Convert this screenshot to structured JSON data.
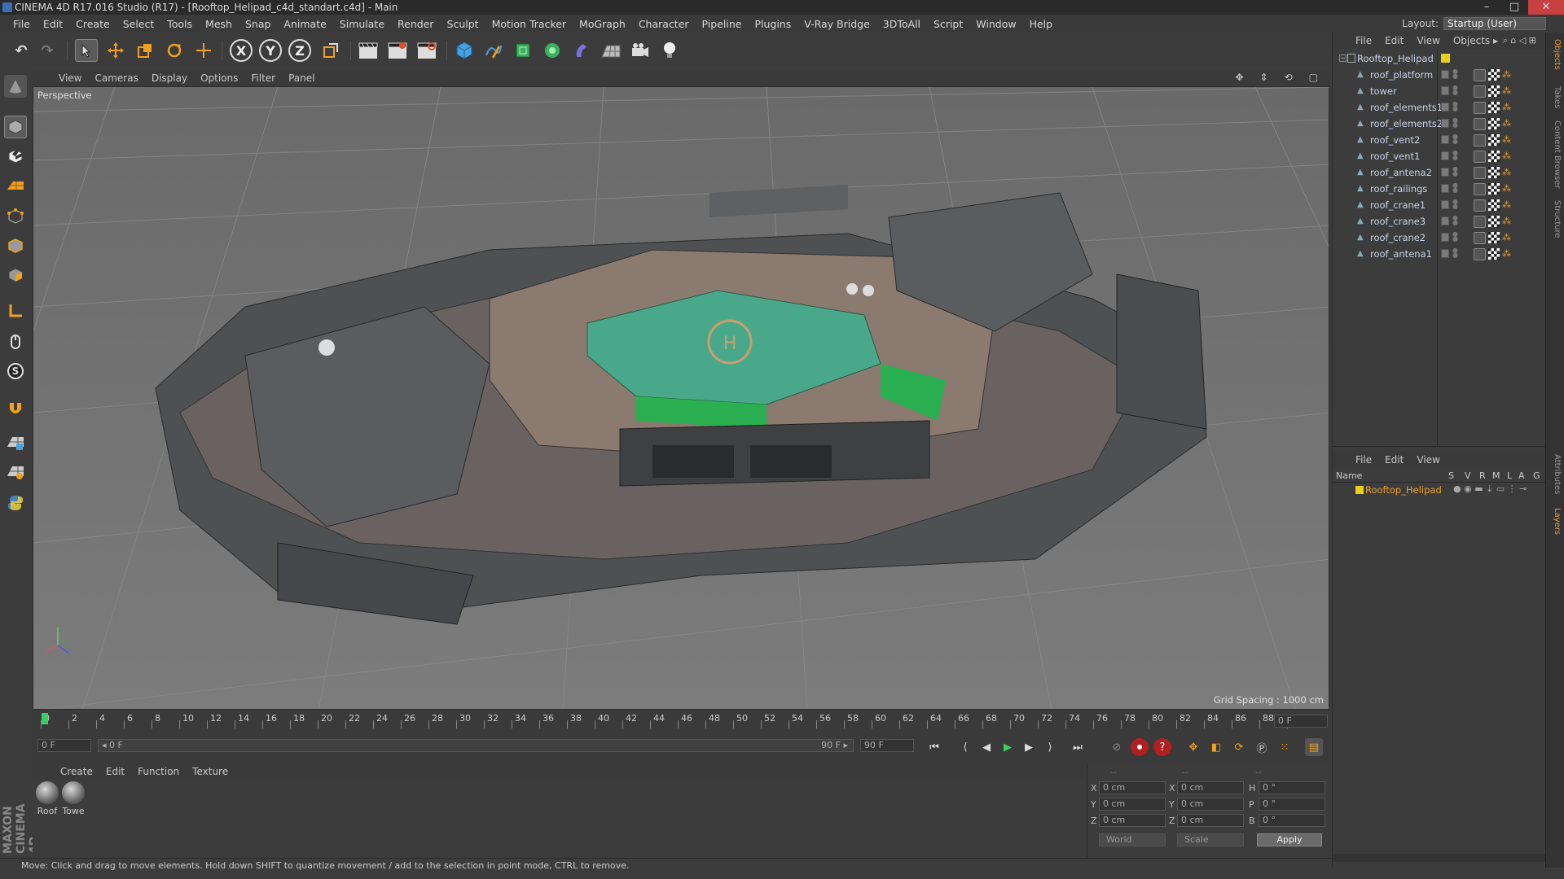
{
  "window": {
    "title": "CINEMA 4D R17.016 Studio (R17) - [Rooftop_Helipad_c4d_standart.c4d] - Main",
    "buttons": [
      "–",
      "□",
      "✕"
    ]
  },
  "menubar": [
    "File",
    "Edit",
    "Create",
    "Select",
    "Tools",
    "Mesh",
    "Snap",
    "Animate",
    "Simulate",
    "Render",
    "Sculpt",
    "Motion Tracker",
    "MoGraph",
    "Character",
    "Pipeline",
    "Plugins",
    "V-Ray Bridge",
    "3DToAll",
    "Script",
    "Window",
    "Help"
  ],
  "layout": {
    "label": "Layout:",
    "value": "Startup (User)"
  },
  "toolbar": {
    "undo": "↶",
    "redo": "↷",
    "axes": [
      "X",
      "Y",
      "Z"
    ]
  },
  "viewport": {
    "menu": [
      "View",
      "Cameras",
      "Display",
      "Options",
      "Filter",
      "Panel"
    ],
    "label": "Perspective",
    "grid_spacing": "Grid Spacing : 1000 cm"
  },
  "timeline": {
    "ticks": [
      "0",
      "2",
      "4",
      "6",
      "8",
      "10",
      "12",
      "14",
      "16",
      "18",
      "20",
      "22",
      "24",
      "26",
      "28",
      "30",
      "32",
      "34",
      "36",
      "38",
      "40",
      "42",
      "44",
      "46",
      "48",
      "50",
      "52",
      "54",
      "56",
      "58",
      "60",
      "62",
      "64",
      "66",
      "68",
      "70",
      "72",
      "74",
      "76",
      "78",
      "80",
      "82",
      "84",
      "86",
      "88",
      "90"
    ],
    "current_frame": "0 F"
  },
  "transport": {
    "start_field": "0 F",
    "range_start": "◂ 0 F",
    "range_end": "90 F ▸",
    "end_field": "90 F"
  },
  "material_manager": {
    "menu": [
      "Create",
      "Edit",
      "Function",
      "Texture"
    ],
    "materials": [
      {
        "label": "Roof"
      },
      {
        "label": "Towe"
      }
    ]
  },
  "coordinates": {
    "headers": [
      "--",
      "--",
      "--"
    ],
    "rows": [
      {
        "a": "X",
        "av": "0 cm",
        "b": "X",
        "bv": "0 cm",
        "c": "H",
        "cv": "0 °"
      },
      {
        "a": "Y",
        "av": "0 cm",
        "b": "Y",
        "bv": "0 cm",
        "c": "P",
        "cv": "0 °"
      },
      {
        "a": "Z",
        "av": "0 cm",
        "b": "Z",
        "bv": "0 cm",
        "c": "B",
        "cv": "0 °"
      }
    ],
    "mode1": "World",
    "mode2": "Scale",
    "apply": "Apply"
  },
  "status_bar": "Move: Click and drag to move elements. Hold down SHIFT to quantize movement / add to the selection in point mode, CTRL to remove.",
  "object_manager": {
    "menu": [
      "File",
      "Edit",
      "View",
      "Objects ▸"
    ],
    "root": "Rooftop_Helipad",
    "objects": [
      "roof_platform",
      "tower",
      "roof_elements1",
      "roof_elements2",
      "roof_vent2",
      "roof_vent1",
      "roof_antena2",
      "roof_railings",
      "roof_crane1",
      "roof_crane3",
      "roof_crane2",
      "roof_antena1"
    ]
  },
  "layer_manager": {
    "menu": [
      "File",
      "Edit",
      "View"
    ],
    "columns": [
      "Name",
      "S",
      "V",
      "R",
      "M",
      "L",
      "A",
      "G"
    ],
    "layers": [
      {
        "name": "Rooftop_Helipad",
        "color": "#e8d020"
      }
    ]
  },
  "side_tabs": [
    "Objects",
    "Takes",
    "Content Browser",
    "Structure",
    "Attributes",
    "Layers"
  ],
  "brand": "MAXON CINEMA 4D",
  "colors": {
    "accent": "#e89a30",
    "layer_text": "#e8a030",
    "viewport_bg": "#707070"
  }
}
